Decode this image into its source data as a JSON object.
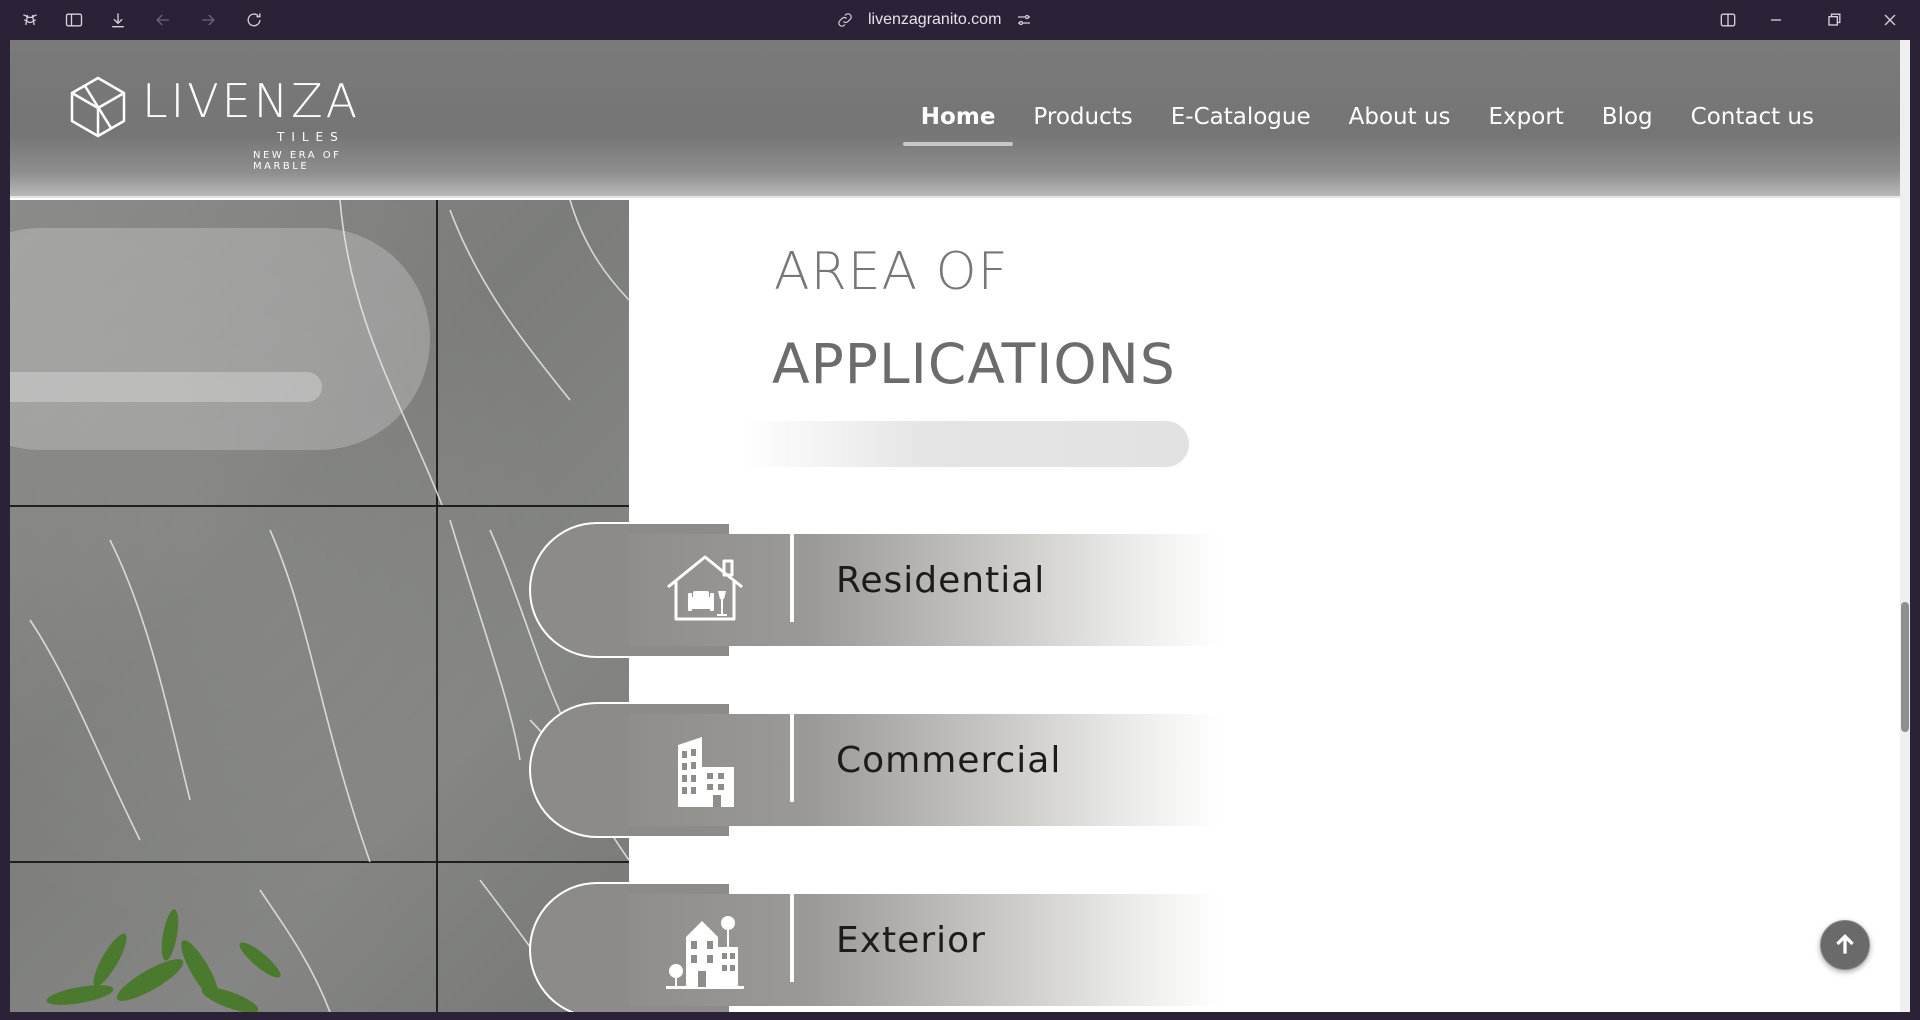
{
  "browser": {
    "url": "livenzagranito.com"
  },
  "logo": {
    "wordmark": "LIVENZA",
    "subtitle": "TILES",
    "tagline": "NEW ERA OF MARBLE"
  },
  "nav": {
    "items": [
      {
        "label": "Home",
        "active": true
      },
      {
        "label": "Products"
      },
      {
        "label": "E-Catalogue"
      },
      {
        "label": "About us"
      },
      {
        "label": "Export"
      },
      {
        "label": "Blog"
      },
      {
        "label": "Contact us"
      }
    ]
  },
  "section": {
    "heading_line1": "AREA OF",
    "heading_line2": "APPLICATIONS",
    "applications": [
      {
        "label": "Residential",
        "icon": "house-icon"
      },
      {
        "label": "Commercial",
        "icon": "office-building-icon"
      },
      {
        "label": "Exterior",
        "icon": "building-exterior-icon"
      }
    ]
  },
  "colors": {
    "header_gray": "#7a7a7a",
    "band_gray": "#908e8a",
    "browser_chrome": "#2b2237"
  }
}
